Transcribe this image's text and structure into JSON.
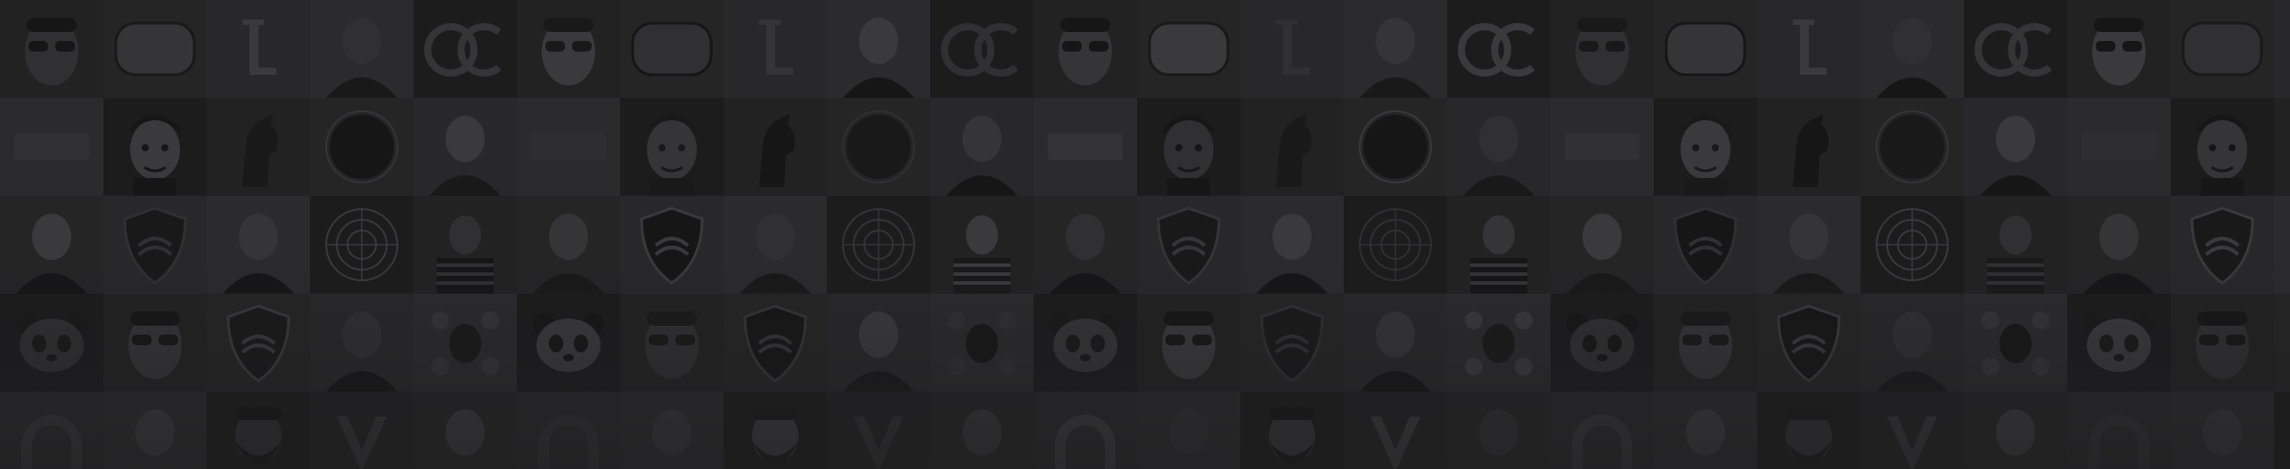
{
  "background": {
    "base_color": "#1e1e1f",
    "tile_palette": [
      "#222223",
      "#252526",
      "#28282a",
      "#2b2b2d",
      "#1c1c1d"
    ],
    "ink_palette": [
      "#161617",
      "#19191a",
      "#303033",
      "#353538",
      "#3a3a3d"
    ],
    "fade_color": "#1e1e1f"
  },
  "mosaic": {
    "row_count": 5,
    "repeat_pattern": [
      [
        "sunglasses-face-avatar",
        "rounded-badge-logo",
        "letter-l-logo",
        "smiling-man-avatar",
        "oc-ring-logo"
      ],
      [
        "blank-dark-avatar",
        "cartoon-man-avatar",
        "horse-head-avatar",
        "dark-circle-avatar",
        "blonde-woman-avatar"
      ],
      [
        "woman-portrait-avatar",
        "shield-logo",
        "man-in-suit-avatar",
        "ornate-pattern-avatar",
        "striped-shirt-woman-avatar"
      ],
      [
        "panda-avatar",
        "man-with-sunglasses-avatar",
        "e-shield-logo",
        "man-face-avatar",
        "floral-pattern-avatar"
      ],
      [
        "arch-logo",
        "dark-profile-avatar",
        "bearded-man-avatar",
        "v-shape-logo",
        "dark-face-avatar"
      ]
    ]
  }
}
